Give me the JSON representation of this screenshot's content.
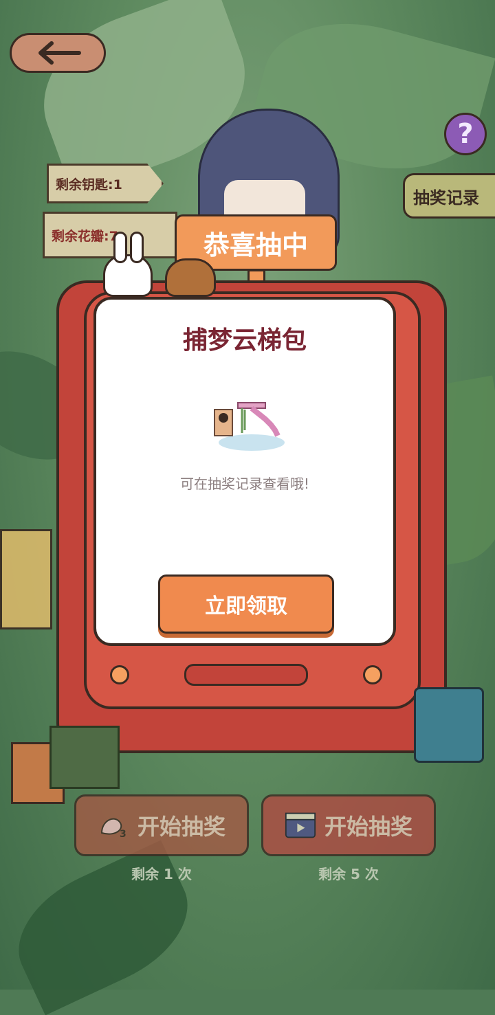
{
  "header": {
    "help_label": "?",
    "record_label": "抽奖记录"
  },
  "signs": {
    "keys": "剩余钥匙:1",
    "petals": "剩余花瓣:7"
  },
  "result": {
    "banner": "恭喜抽中",
    "prize_name": "捕梦云梯包",
    "hint": "可在抽奖记录查看哦!",
    "claim_label": "立即领取"
  },
  "draw": {
    "petal_button_label": "开始抽奖",
    "petal_remaining": "剩余 1 次",
    "video_button_label": "开始抽奖",
    "video_remaining": "剩余 5 次"
  },
  "colors": {
    "accent_orange": "#f08a4e",
    "machine_red": "#c2443a",
    "prize_title": "#7a2533",
    "help_purple": "#8c5bb5"
  }
}
